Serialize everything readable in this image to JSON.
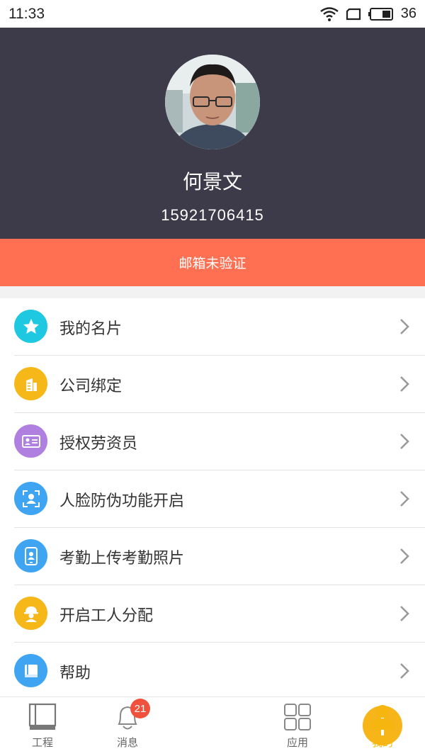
{
  "status_bar": {
    "time": "11:33",
    "battery": "36"
  },
  "profile": {
    "name": "何景文",
    "phone": "15921706415"
  },
  "email_notice": "邮箱未验证",
  "menu": [
    {
      "label": "我的名片",
      "icon": "star-icon",
      "color": "#1ec8e0"
    },
    {
      "label": "公司绑定",
      "icon": "building-icon",
      "color": "#f6b718"
    },
    {
      "label": "授权劳资员",
      "icon": "id-card-icon",
      "color": "#b080e0"
    },
    {
      "label": "人脸防伪功能开启",
      "icon": "face-scan-icon",
      "color": "#3fa5f2"
    },
    {
      "label": "考勤上传考勤照片",
      "icon": "phone-photo-icon",
      "color": "#3fa5f2"
    },
    {
      "label": "开启工人分配",
      "icon": "worker-helmet-icon",
      "color": "#f6b718"
    },
    {
      "label": "帮助",
      "icon": "book-icon",
      "color": "#3fa5f2"
    }
  ],
  "bottom_nav": {
    "items": [
      {
        "label": "工程",
        "icon": "project-icon"
      },
      {
        "label": "消息",
        "icon": "bell-icon",
        "badge": "21"
      },
      {
        "label": "",
        "icon": "add-icon"
      },
      {
        "label": "应用",
        "icon": "grid-icon"
      },
      {
        "label": "我的",
        "icon": "user-icon"
      }
    ],
    "active_index": 4,
    "accent": "#f5b60f"
  }
}
